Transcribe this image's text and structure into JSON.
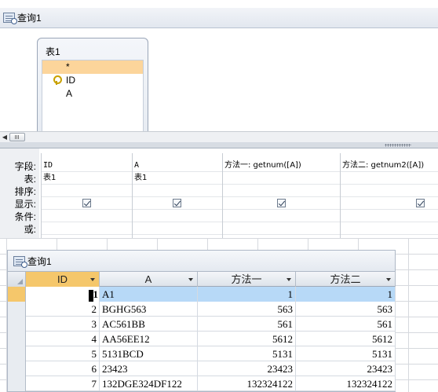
{
  "designer": {
    "title": "查询1",
    "table": {
      "name": "表1",
      "fields": [
        "*",
        "ID",
        "A"
      ]
    },
    "row_labels": [
      "字段:",
      "表:",
      "排序:",
      "显示:",
      "条件:",
      "或:"
    ],
    "columns": [
      {
        "field": "ID",
        "table": "表1",
        "show": true
      },
      {
        "field": "A",
        "table": "表1",
        "show": true
      },
      {
        "field": "方法一: getnum([A])",
        "table": "",
        "show": true
      },
      {
        "field": "方法二: getnum2([A])",
        "table": "",
        "show": true
      }
    ]
  },
  "datasheet": {
    "title": "查询1",
    "headers": [
      "ID",
      "A",
      "方法一",
      "方法二"
    ],
    "rows": [
      {
        "id": "1",
        "a": "A1",
        "m1": "1",
        "m2": "1"
      },
      {
        "id": "2",
        "a": "BGHG563",
        "m1": "563",
        "m2": "563"
      },
      {
        "id": "3",
        "a": "AC561BB",
        "m1": "561",
        "m2": "561"
      },
      {
        "id": "4",
        "a": "AA56EE12",
        "m1": "5612",
        "m2": "5612"
      },
      {
        "id": "5",
        "a": "5131BCD",
        "m1": "5131",
        "m2": "5131"
      },
      {
        "id": "6",
        "a": "23423",
        "m1": "23423",
        "m2": "23423"
      },
      {
        "id": "7",
        "a": "132DGE324DF122",
        "m1": "132324122",
        "m2": "132324122"
      }
    ]
  },
  "icons": {
    "query": "query-icon",
    "key": "primary-key-icon",
    "check": "checkbox-checked-icon"
  }
}
